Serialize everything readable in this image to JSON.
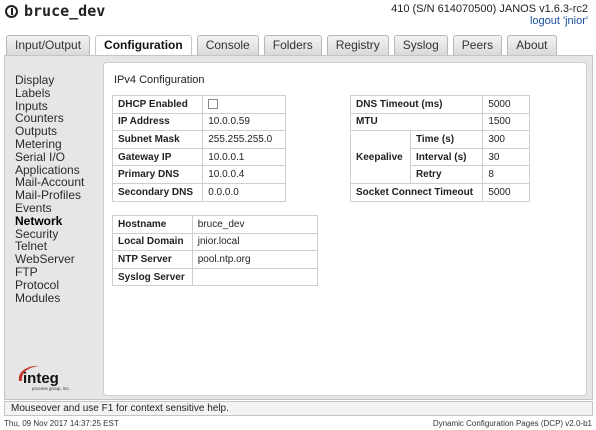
{
  "header": {
    "title": "bruce_dev",
    "device_info": "410 (S/N 614070500) JANOS v1.6.3-rc2",
    "logout_link": "logout 'jnior'"
  },
  "tabs": [
    {
      "label": "Input/Output"
    },
    {
      "label": "Configuration"
    },
    {
      "label": "Console"
    },
    {
      "label": "Folders"
    },
    {
      "label": "Registry"
    },
    {
      "label": "Syslog"
    },
    {
      "label": "Peers"
    },
    {
      "label": "About"
    }
  ],
  "active_tab": "Configuration",
  "sidebar": {
    "items": [
      {
        "label": "Display"
      },
      {
        "label": "Labels"
      },
      {
        "label": "Inputs"
      },
      {
        "label": "Counters"
      },
      {
        "label": "Outputs"
      },
      {
        "label": "Metering"
      },
      {
        "label": "Serial I/O"
      },
      {
        "label": "Applications"
      },
      {
        "label": "Mail-Account"
      },
      {
        "label": "Mail-Profiles"
      },
      {
        "label": "Events"
      },
      {
        "label": "Network"
      },
      {
        "label": "Security"
      },
      {
        "label": "Telnet"
      },
      {
        "label": "WebServer"
      },
      {
        "label": "FTP"
      },
      {
        "label": "Protocol"
      },
      {
        "label": "Modules"
      }
    ],
    "active": "Network"
  },
  "logo": {
    "brand": "integ",
    "tagline": "process group, inc."
  },
  "section": {
    "title": "IPv4 Configuration"
  },
  "ipv4": {
    "dhcp_label": "DHCP Enabled",
    "dhcp_checked": false,
    "ip_label": "IP Address",
    "ip_value": "10.0.0.59",
    "mask_label": "Subnet Mask",
    "mask_value": "255.255.255.0",
    "gateway_label": "Gateway IP",
    "gateway_value": "10.0.0.1",
    "pdns_label": "Primary DNS",
    "pdns_value": "10.0.0.4",
    "sdns_label": "Secondary DNS",
    "sdns_value": "0.0.0.0"
  },
  "net": {
    "dns_timeout_label": "DNS Timeout (ms)",
    "dns_timeout_value": "5000",
    "mtu_label": "MTU",
    "mtu_value": "1500",
    "keepalive_label": "Keepalive",
    "time_label": "Time (s)",
    "time_value": "300",
    "interval_label": "Interval (s)",
    "interval_value": "30",
    "retry_label": "Retry",
    "retry_value": "8",
    "sock_timeout_label": "Socket Connect Timeout",
    "sock_timeout_value": "5000"
  },
  "host": {
    "hostname_label": "Hostname",
    "hostname_value": "bruce_dev",
    "domain_label": "Local Domain",
    "domain_value": "jnior.local",
    "ntp_label": "NTP Server",
    "ntp_value": "pool.ntp.org",
    "syslog_label": "Syslog Server",
    "syslog_value": ""
  },
  "statusbar": {
    "text": "Mouseover and use F1 for context sensitive help."
  },
  "footer": {
    "datetime": "Thu, 09 Nov 2017 14:37:25 EST",
    "version": "Dynamic Configuration Pages (DCP) v2.0-b1"
  },
  "colors": {
    "link": "#1a4fa0",
    "panel_bg": "#e6e6e6",
    "logo_red": "#c0392b"
  }
}
